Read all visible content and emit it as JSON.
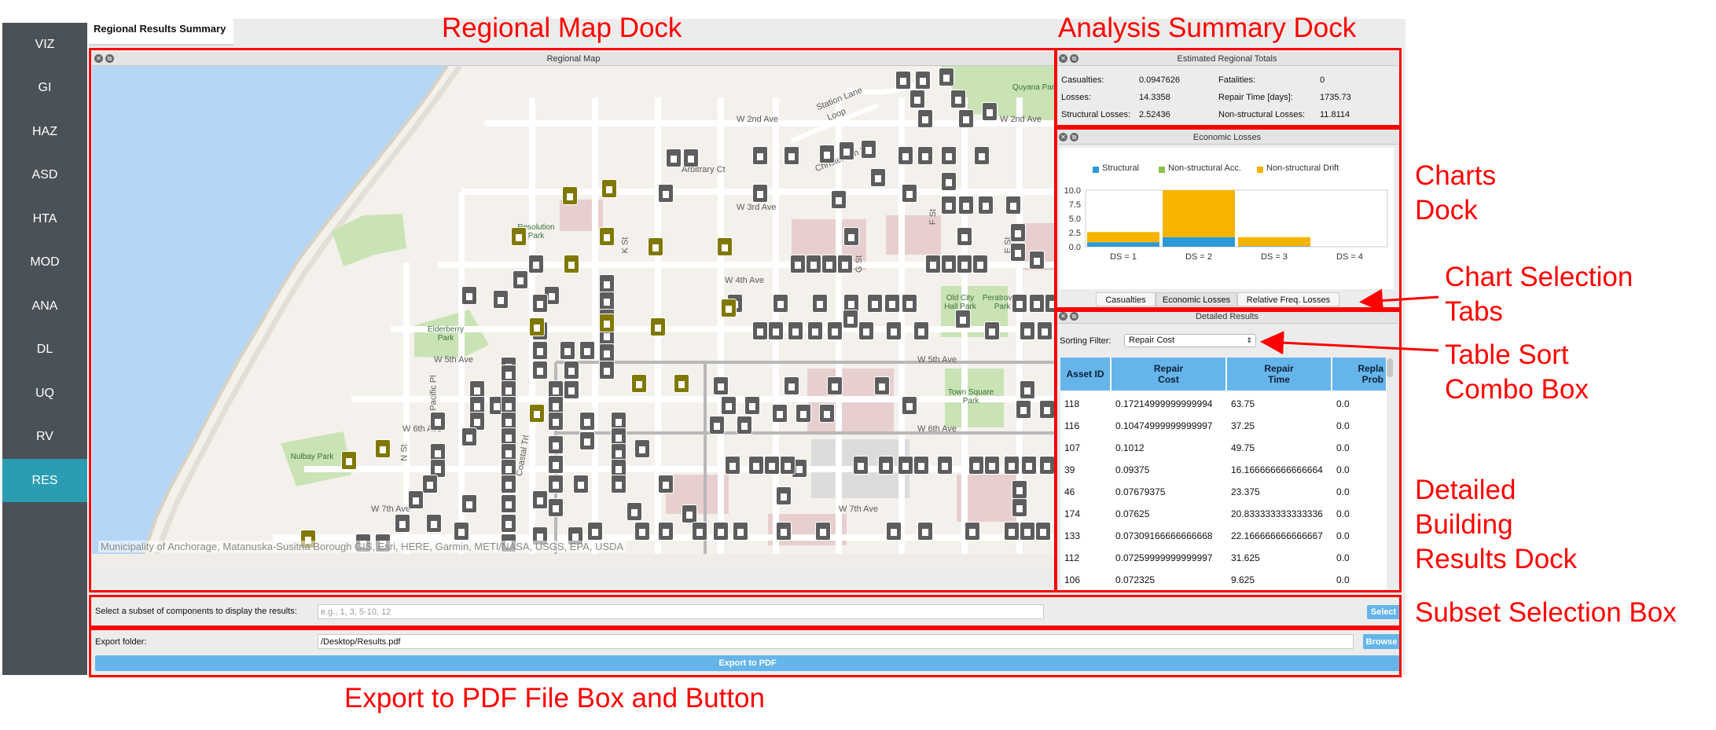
{
  "nav": {
    "items": [
      {
        "label": "VIZ"
      },
      {
        "label": "GI"
      },
      {
        "label": "HAZ"
      },
      {
        "label": "ASD"
      },
      {
        "label": "HTA"
      },
      {
        "label": "MOD"
      },
      {
        "label": "ANA"
      },
      {
        "label": "DL"
      },
      {
        "label": "UQ"
      },
      {
        "label": "RV"
      },
      {
        "label": "RES"
      }
    ],
    "active": "RES",
    "active_color": "#2b9db3"
  },
  "results_tab": {
    "label": "Regional Results Summary"
  },
  "map": {
    "title": "Regional Map",
    "attribution": "Municipality of Anchorage, Matanuska-Susitna Borough GIS, Esri, HERE, Garmin, METI/NASA, USGS, EPA, USDA",
    "streets": [
      "W 2nd Ave",
      "W 2nd Ave",
      "Arbitrary Ct",
      "W 3rd Ave",
      "W 4th Ave",
      "W 5th Ave",
      "W 5th Ave",
      "W 6th Ave",
      "W 6th Ave",
      "W 7th Ave",
      "W 7th Ave",
      "Station Lane",
      "Loop",
      "Christensen Dr",
      "Pacific Pl",
      "N St",
      "K St",
      "G St",
      "F St",
      "E St",
      "Coastal Trl"
    ],
    "parks": [
      "Resolution Park",
      "Elderberry Park",
      "Nulbay Park",
      "Old City Hall Park",
      "Peratrovich Park",
      "Town Square Park",
      "Quyana Park"
    ]
  },
  "summary": {
    "title": "Estimated Regional Totals",
    "items": [
      {
        "label": "Casualties:",
        "value": "0.0947626"
      },
      {
        "label": "Fatalities:",
        "value": "0"
      },
      {
        "label": "Losses:",
        "value": "14.3358"
      },
      {
        "label": "Repair Time [days]:",
        "value": "1735.73"
      },
      {
        "label": "Structural Losses:",
        "value": "2.52436"
      },
      {
        "label": "Non-structural Losses:",
        "value": "11.8114"
      }
    ]
  },
  "charts": {
    "title": "Economic Losses",
    "tabs": [
      "Casualties",
      "Economic Losses",
      "Relative Freq. Losses"
    ],
    "active_tab": "Economic Losses"
  },
  "chart_data": {
    "type": "bar",
    "stacked": true,
    "categories": [
      "DS = 1",
      "DS = 2",
      "DS = 3",
      "DS = 4"
    ],
    "series": [
      {
        "name": "Structural",
        "color": "#2a9ad9",
        "values": [
          0.8,
          1.7,
          0.1,
          0.0
        ]
      },
      {
        "name": "Non-structural Acc.",
        "color": "#8bc34a",
        "values": [
          0.0,
          0.0,
          0.0,
          0.0
        ]
      },
      {
        "name": "Non-structural Drift",
        "color": "#f6b400",
        "values": [
          1.8,
          8.3,
          1.6,
          0.0
        ]
      }
    ],
    "ylim": [
      0,
      10
    ],
    "yticks": [
      "0.0",
      "2.5",
      "5.0",
      "7.5",
      "10.0"
    ],
    "legend": "top"
  },
  "details": {
    "title": "Detailed Results",
    "sort_label": "Sorting Filter:",
    "sort_value": "Repair Cost",
    "columns": [
      {
        "line1": "Asset ID",
        "line2": ""
      },
      {
        "line1": "Repair",
        "line2": "Cost"
      },
      {
        "line1": "Repair",
        "line2": "Time"
      },
      {
        "line1": "Repla",
        "line2": "Prob"
      }
    ],
    "rows": [
      [
        "118",
        "0.17214999999999994",
        "63.75",
        "0.0"
      ],
      [
        "116",
        "0.10474999999999997",
        "37.25",
        "0.0"
      ],
      [
        "107",
        "0.1012",
        "49.75",
        "0.0"
      ],
      [
        "39",
        "0.09375",
        "16.166666666666664",
        "0.0"
      ],
      [
        "46",
        "0.07679375",
        "23.375",
        "0.0"
      ],
      [
        "174",
        "0.07625",
        "20.833333333333336",
        "0.0"
      ],
      [
        "133",
        "0.07309166666666668",
        "22.166666666666667",
        "0.0"
      ],
      [
        "112",
        "0.07259999999999997",
        "31.625",
        "0.0"
      ],
      [
        "106",
        "0.072325",
        "9.625",
        "0.0"
      ]
    ]
  },
  "subset": {
    "label": "Select a subset of components to display the results:",
    "placeholder": "e.g., 1, 3, 5-10, 12",
    "button": "Select"
  },
  "export": {
    "label": "Export folder:",
    "value": "/Desktop/Results.pdf",
    "browse": "Browse",
    "button": "Export to PDF"
  },
  "annotations": {
    "color": "#ff0000",
    "map_dock": "Regional Map Dock",
    "summary_dock": "Analysis Summary Dock",
    "charts_dock_1": "Charts",
    "charts_dock_2": "Dock",
    "chart_tabs_1": "Chart Selection",
    "chart_tabs_2": "Tabs",
    "table_sort_1": "Table Sort",
    "table_sort_2": "Combo Box",
    "detailed_1": "Detailed",
    "detailed_2": "Building",
    "detailed_3": "Results Dock",
    "subset_box": "Subset Selection Box",
    "export_box": "Export to PDF File Box and Button"
  }
}
